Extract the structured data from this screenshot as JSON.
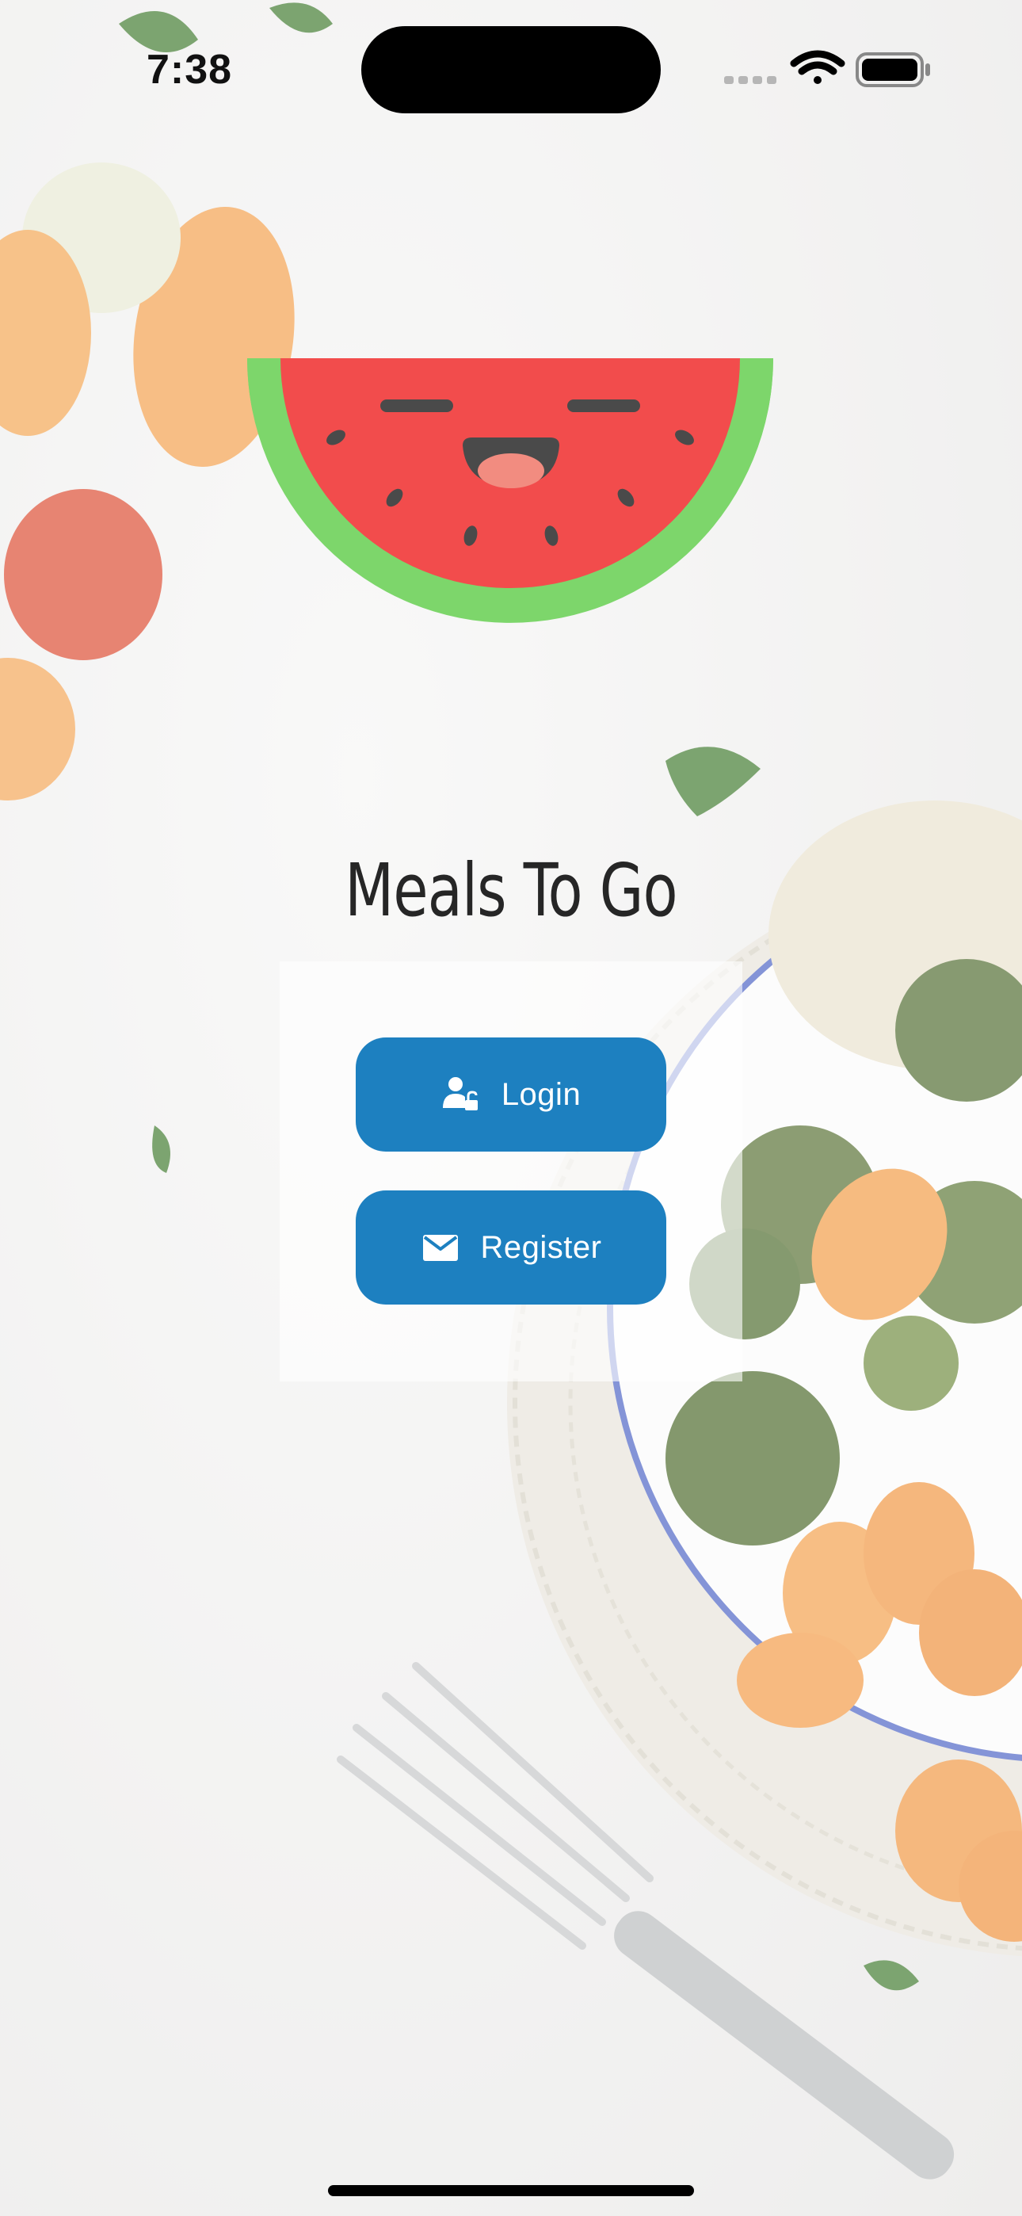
{
  "status_bar": {
    "time": "7:38"
  },
  "app": {
    "title": "Meals To Go",
    "logo_icon": "watermelon-smile-icon"
  },
  "actions": {
    "login_label": "Login",
    "login_icon": "user-unlock-icon",
    "register_label": "Register",
    "register_icon": "envelope-icon"
  },
  "colors": {
    "button": "#1d80c0",
    "button_text": "#ffffff",
    "watermelon_rind": "#7dd66b",
    "watermelon_flesh": "#f24c4c",
    "title_text": "#262626"
  }
}
